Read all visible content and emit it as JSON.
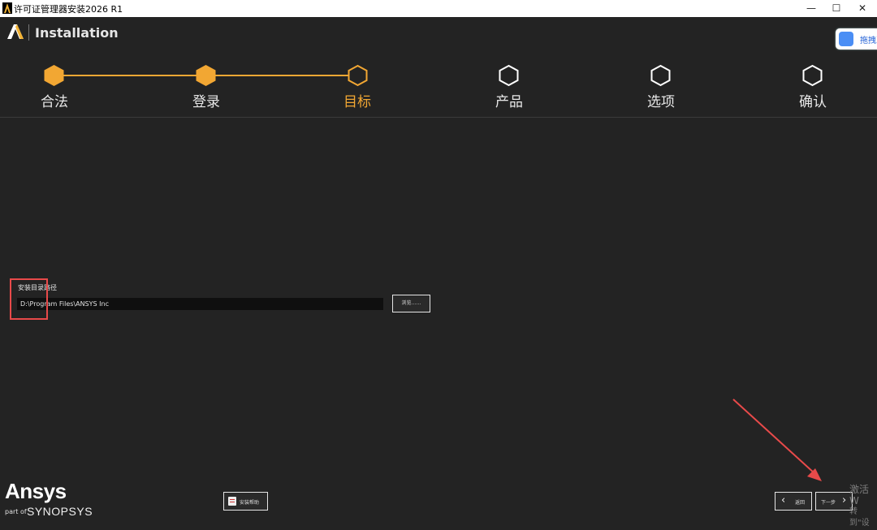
{
  "window": {
    "title": "许可证管理器安装2026 R1",
    "minimize_glyph": "—",
    "maximize_glyph": "☐",
    "close_glyph": "✕"
  },
  "header": {
    "app_name": "Installation",
    "cloud_widget_label": "拖拽到"
  },
  "steps": [
    {
      "label": "合法",
      "state": "done"
    },
    {
      "label": "登录",
      "state": "done"
    },
    {
      "label": "目标",
      "state": "current"
    },
    {
      "label": "产品",
      "state": "pending"
    },
    {
      "label": "选项",
      "state": "pending"
    },
    {
      "label": "确认",
      "state": "pending"
    }
  ],
  "form": {
    "path_label": "安装目录路径",
    "path_value": "D:\\Program Files\\ANSYS Inc",
    "browse_label": "浏览……"
  },
  "footer": {
    "brand": "Ansys",
    "part_of": "part of",
    "parent_brand": "SYNOPSYS",
    "help_label": "安装帮助",
    "back_label": "返回",
    "next_label": "下一步"
  },
  "watermark": {
    "line1": "激活 W",
    "line2": "转到\"设"
  },
  "colors": {
    "accent": "#f2a733",
    "background": "#232323",
    "annotation": "#e84a4a"
  }
}
